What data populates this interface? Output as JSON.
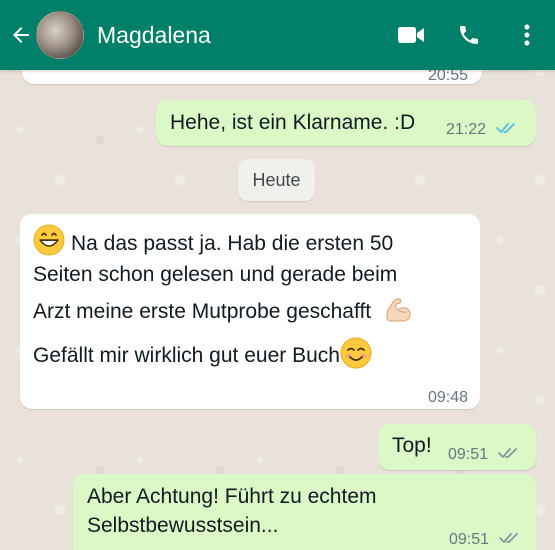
{
  "header": {
    "contact_name": "Magdalena",
    "icons": [
      "back-arrow-icon",
      "video-call-icon",
      "phone-icon",
      "more-vert-icon"
    ],
    "color": "#008069"
  },
  "messages": {
    "partial_top_time": "20:55",
    "msg1": {
      "text": "Hehe, ist ein Klarname. :D",
      "time": "21:22",
      "status": "read"
    },
    "date_chip": "Heute",
    "msg2": {
      "line1": "Na das passt ja. Hab die ersten 50",
      "line2": "Seiten schon gelesen und gerade beim",
      "line3": "Arzt meine erste Mutprobe geschafft",
      "line4": "Gefällt mir wirklich gut euer Buch",
      "time": "09:48",
      "emojis": [
        "grinning-face-icon",
        "flexed-biceps-icon",
        "smiling-face-icon"
      ]
    },
    "msg3": {
      "text": "Top!",
      "time": "09:51",
      "status": "delivered"
    },
    "msg4": {
      "line1": "Aber Achtung! Führt zu echtem",
      "line2": "Selbstbewusstsein...",
      "time": "09:51",
      "status": "delivered"
    }
  },
  "colors": {
    "outgoing_bubble": "#DCF8C6",
    "incoming_bubble": "#FFFFFF",
    "read_tick": "#53BDEB",
    "delivered_tick": "#8696A0"
  }
}
